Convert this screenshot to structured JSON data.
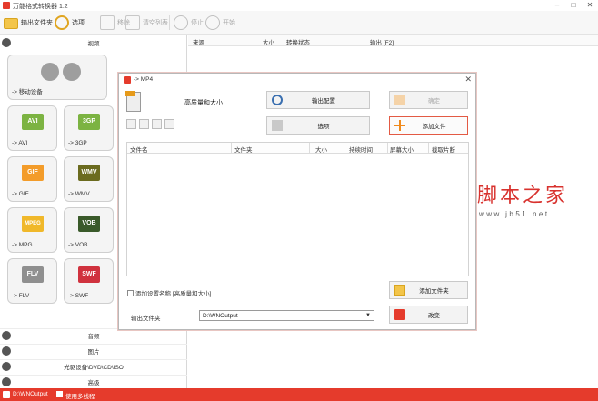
{
  "app": {
    "title": "万能格式转换器 1.2"
  },
  "window_controls": {
    "minimize": "–",
    "maximize": "□",
    "close": "✕"
  },
  "toolbar": {
    "output_folder": "输出文件夹",
    "options": "选项",
    "remove": "移除",
    "clear_list": "清空列表",
    "stop": "停止",
    "start": "开始"
  },
  "sidebar": {
    "video_header": "视频",
    "tiles": [
      {
        "badge": "",
        "label": "-> 移动设备",
        "color": "#9e9e9e"
      },
      {
        "badge": "AVI",
        "label": "-> AVI",
        "color": "#7cb342"
      },
      {
        "badge": "3GP",
        "label": "-> 3GP",
        "color": "#7cb342"
      },
      {
        "badge": "GIF",
        "label": "-> GIF",
        "color": "#f39c2a"
      },
      {
        "badge": "WMV",
        "label": "-> WMV",
        "color": "#6b6b1f"
      },
      {
        "badge": "MPEG",
        "label": "-> MPG",
        "color": "#f0b82a"
      },
      {
        "badge": "VOB",
        "label": "-> VOB",
        "color": "#3a5a2a"
      },
      {
        "badge": "FLV",
        "label": "-> FLV",
        "color": "#8f8f8f"
      },
      {
        "badge": "SWF",
        "label": "-> SWF",
        "color": "#d0323e"
      }
    ],
    "bottom": [
      {
        "label": "音频"
      },
      {
        "label": "图片"
      },
      {
        "label": "光驱设备\\DVD\\CD\\ISO"
      },
      {
        "label": "高级"
      }
    ]
  },
  "file_list": {
    "columns": [
      "来源",
      "大小",
      "转换状态",
      "输出 [F2]"
    ]
  },
  "dialog": {
    "title": "-> MP4",
    "quality": "高质量和大小",
    "output_config": "输出配置",
    "confirm": "确定",
    "options": "选项",
    "add_file": "添加文件",
    "columns": [
      "文件名",
      "文件夹",
      "大小",
      "持续时间",
      "屏幕大小",
      "截取片断"
    ],
    "add_setting_name": "添加设置名称 [高质量和大小]",
    "add_folder": "添加文件夹",
    "output_folder_label": "输出文件夹",
    "output_folder_value": "D:\\WNOutput",
    "change": "改变"
  },
  "status_bar": {
    "path": "D:\\WNOutput",
    "multithread": "使用多线程"
  },
  "watermark": {
    "main": "脚本之家",
    "url": "www.jb51.net"
  },
  "colors": {
    "accent": "#e53b2c",
    "highlight_border": "#e35a44"
  }
}
